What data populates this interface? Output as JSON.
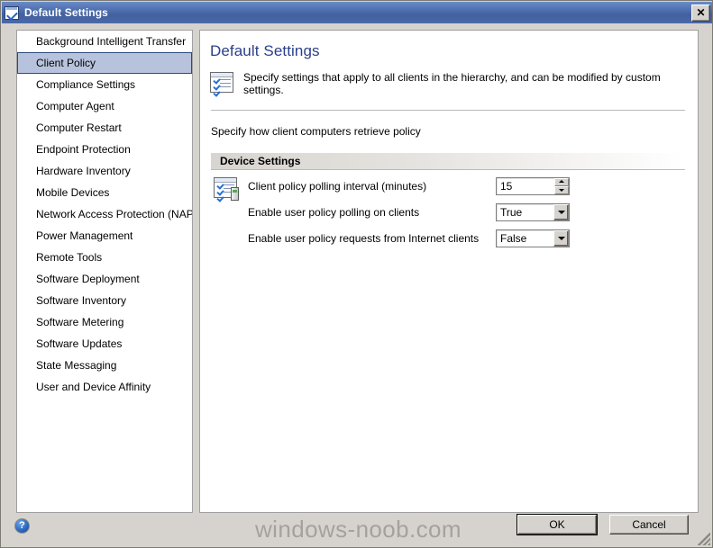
{
  "window": {
    "title": "Default Settings",
    "icon": "checklist-window-icon",
    "close_label": "✕"
  },
  "sidebar": {
    "items": [
      {
        "label": "Background Intelligent Transfer",
        "selected": false
      },
      {
        "label": "Client Policy",
        "selected": true
      },
      {
        "label": "Compliance Settings",
        "selected": false
      },
      {
        "label": "Computer Agent",
        "selected": false
      },
      {
        "label": "Computer Restart",
        "selected": false
      },
      {
        "label": "Endpoint Protection",
        "selected": false
      },
      {
        "label": "Hardware Inventory",
        "selected": false
      },
      {
        "label": "Mobile Devices",
        "selected": false
      },
      {
        "label": "Network Access Protection (NAP)",
        "selected": false
      },
      {
        "label": "Power Management",
        "selected": false
      },
      {
        "label": "Remote Tools",
        "selected": false
      },
      {
        "label": "Software Deployment",
        "selected": false
      },
      {
        "label": "Software Inventory",
        "selected": false
      },
      {
        "label": "Software Metering",
        "selected": false
      },
      {
        "label": "Software Updates",
        "selected": false
      },
      {
        "label": "State Messaging",
        "selected": false
      },
      {
        "label": "User and Device Affinity",
        "selected": false
      }
    ]
  },
  "content": {
    "title": "Default Settings",
    "description": "Specify settings that apply to all clients in the hierarchy, and can be modified by custom settings.",
    "subtitle": "Specify how client computers retrieve policy",
    "section": {
      "header": "Device Settings",
      "rows": [
        {
          "label": "Client policy polling interval (minutes)",
          "value": "15",
          "control": "spinner"
        },
        {
          "label": "Enable user policy polling on clients",
          "value": "True",
          "control": "dropdown",
          "options": [
            "True",
            "False"
          ]
        },
        {
          "label": "Enable user policy requests from Internet clients",
          "value": "False",
          "control": "dropdown",
          "options": [
            "True",
            "False"
          ]
        }
      ]
    }
  },
  "footer": {
    "help_label": "?",
    "watermark": "windows-noob.com",
    "ok_label": "OK",
    "cancel_label": "Cancel"
  },
  "colors": {
    "titlebar_blue": "#4f70b0",
    "heading_blue": "#2b3f8c",
    "selection_fill": "#b7c3dd",
    "selection_border": "#2b4a80",
    "dialog_face": "#d6d3ce",
    "watermark_gray": "#a5a29d"
  }
}
